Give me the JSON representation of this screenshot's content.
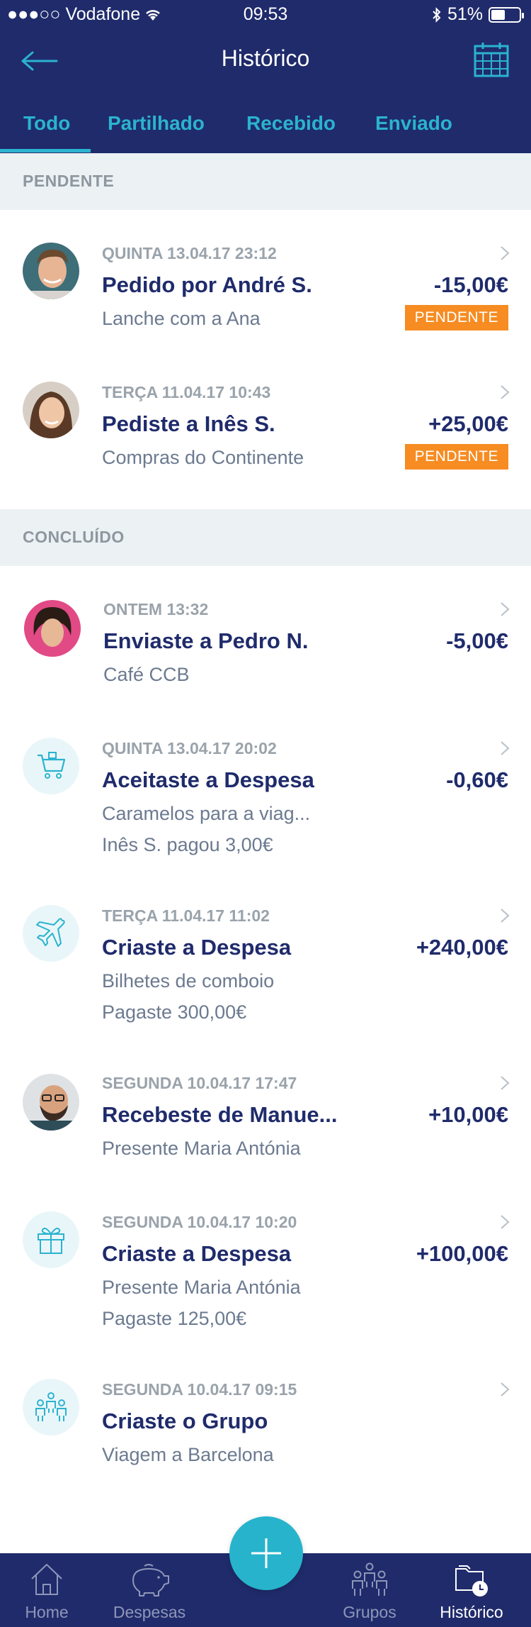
{
  "status_bar": {
    "carrier": "●●●○○ Vodafone",
    "time": "09:53",
    "battery": "51%",
    "battery_level": 0.51
  },
  "header": {
    "title": "Histórico",
    "back_icon": "arrow-left-icon",
    "calendar_icon": "calendar-icon"
  },
  "tabs": [
    {
      "label": "Todo",
      "active": true
    },
    {
      "label": "Partilhado",
      "active": false
    },
    {
      "label": "Recebido",
      "active": false
    },
    {
      "label": "Enviado",
      "active": false
    }
  ],
  "sections": {
    "pending": "PENDENTE",
    "done": "CONCLUÍDO"
  },
  "items": [
    {
      "date": "QUINTA 13.04.17 23:12",
      "title": "Pedido por André S.",
      "sub1": "Lanche com a Ana",
      "sub2": "",
      "amount": "-15,00€",
      "badge": "PENDENTE",
      "avatar": "person-andre"
    },
    {
      "date": "TERÇA 11.04.17 10:43",
      "title": "Pediste a Inês S.",
      "sub1": "Compras do Continente",
      "sub2": "",
      "amount": "+25,00€",
      "badge": "PENDENTE",
      "avatar": "person-ines"
    },
    {
      "date": "ONTEM 13:32",
      "title": "Enviaste a Pedro N.",
      "sub1": "Café CCB",
      "sub2": "",
      "amount": "-5,00€",
      "badge": "",
      "avatar": "person-pedro"
    },
    {
      "date": "QUINTA 13.04.17 20:02",
      "title": "Aceitaste a Despesa",
      "sub1": "Caramelos para a viag...",
      "sub2": "Inês S. pagou 3,00€",
      "amount": "-0,60€",
      "badge": "",
      "avatar": "shopping-cart-icon"
    },
    {
      "date": "TERÇA 11.04.17 11:02",
      "title": "Criaste a Despesa",
      "sub1": "Bilhetes de comboio",
      "sub2": "Pagaste 300,00€",
      "amount": "+240,00€",
      "badge": "",
      "avatar": "airplane-icon"
    },
    {
      "date": "SEGUNDA 10.04.17 17:47",
      "title": "Recebeste de Manue...",
      "sub1": "Presente Maria Antónia",
      "sub2": "",
      "amount": "+10,00€",
      "badge": "",
      "avatar": "person-manuel"
    },
    {
      "date": "SEGUNDA 10.04.17 10:20",
      "title": "Criaste a Despesa",
      "sub1": "Presente Maria Antónia",
      "sub2": "Pagaste 125,00€",
      "amount": "+100,00€",
      "badge": "",
      "avatar": "gift-icon"
    },
    {
      "date": "SEGUNDA 10.04.17 09:15",
      "title": "Criaste o Grupo",
      "sub1": "Viagem a Barcelona",
      "sub2": "",
      "amount": "",
      "badge": "",
      "avatar": "group-icon"
    }
  ],
  "fab": {
    "icon": "plus-icon"
  },
  "bottom_nav": [
    {
      "label": "Home",
      "icon": "home-icon",
      "active": false
    },
    {
      "label": "Despesas",
      "icon": "piggy-bank-icon",
      "active": false
    },
    {
      "label": "Grupos",
      "icon": "group-icon",
      "active": false
    },
    {
      "label": "Histórico",
      "icon": "history-folder-icon",
      "active": true
    }
  ],
  "colors": {
    "navy": "#1f2b6b",
    "accent": "#2bb3cf",
    "badge": "#f68c22",
    "section_bg": "#ecf1f4"
  }
}
